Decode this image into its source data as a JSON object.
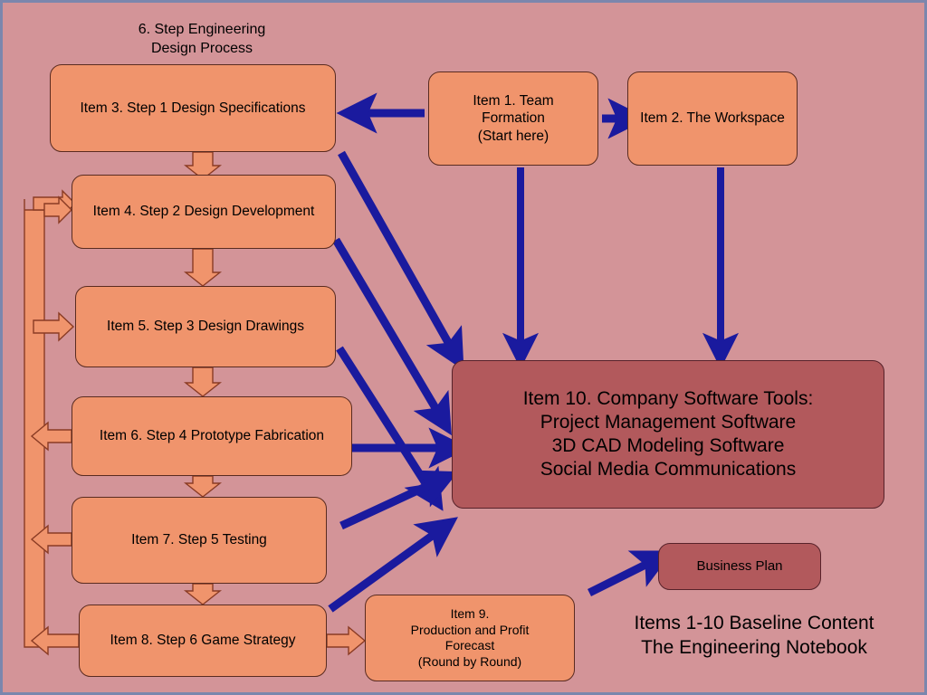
{
  "page": {
    "background_color": "#d39498",
    "border_color": "#7b86ad",
    "node_fill": "#f0946c",
    "node_border": "#5a2b20",
    "dark_node_fill": "#b2595c",
    "dark_node_border": "#57222a",
    "blue_arrow_color": "#1a1a9e",
    "peach_arrow_fill": "#f0946c",
    "peach_arrow_stroke": "#8a3b24"
  },
  "heading": {
    "line1": "6. Step Engineering",
    "line2": "Design Process"
  },
  "nodes": {
    "item1": {
      "line1": "Item 1. Team",
      "line2": "Formation",
      "line3": "(Start here)"
    },
    "item2": {
      "line1": "Item 2. The Workspace"
    },
    "item3": {
      "line1": "Item 3.  Step 1 Design Specifications"
    },
    "item4": {
      "line1": "Item 4.  Step 2 Design Development"
    },
    "item5": {
      "line1": "Item 5.  Step 3 Design  Drawings"
    },
    "item6": {
      "line1": "Item 6.  Step  4 Prototype Fabrication"
    },
    "item7": {
      "line1": "Item 7. Step 5  Testing"
    },
    "item8": {
      "line1": "Item 8. Step 6 Game Strategy"
    },
    "item9": {
      "line1": "Item 9.",
      "line2": "Production and Profit",
      "line3": "Forecast",
      "line4": "(Round by Round)"
    },
    "item10": {
      "line1": "Item 10. Company Software Tools:",
      "line2": "Project Management Software",
      "line3": "3D CAD Modeling Software",
      "line4": "Social Media Communications"
    },
    "business_plan": {
      "line1": "Business Plan"
    }
  },
  "baseline_note": {
    "line1": "Items 1-10 Baseline Content",
    "line2": "The  Engineering Notebook"
  },
  "connectors": {
    "blue_arrows": [
      {
        "name": "item1-to-item3",
        "from": "Item 1. Team Formation",
        "to": "Item 3. Step 1 Design Specifications",
        "direction": "left"
      },
      {
        "name": "item1-to-item2",
        "from": "Item 1. Team Formation",
        "to": "Item 2. The Workspace",
        "direction": "right"
      },
      {
        "name": "item1-to-item10",
        "from": "Item 1. Team Formation",
        "to": "Item 10. Company Software Tools",
        "direction": "down"
      },
      {
        "name": "item2-to-item10",
        "from": "Item 2. The Workspace",
        "to": "Item 10. Company Software Tools",
        "direction": "down"
      },
      {
        "name": "item3-to-item10",
        "from": "Item 3. Step 1 Design Specifications",
        "to": "Item 10. Company Software Tools",
        "direction": "diagonal-down-right"
      },
      {
        "name": "item4-to-item10",
        "from": "Item 4. Step 2 Design Development",
        "to": "Item 10. Company Software Tools",
        "direction": "diagonal-down-right"
      },
      {
        "name": "item6-to-item10",
        "from": "Item 6. Step 4 Prototype Fabrication",
        "to": "Item 10. Company Software Tools",
        "direction": "right"
      },
      {
        "name": "item5-to-item10",
        "from": "Item 5. Step 3 Design Drawings",
        "to": "Item 10. Company Software Tools",
        "direction": "diagonal-down-right"
      },
      {
        "name": "item7-to-item10",
        "from": "Item 7. Step 5 Testing",
        "to": "Item 10. Company Software Tools",
        "direction": "diagonal-up-right"
      },
      {
        "name": "item8-to-item10",
        "from": "Item 8. Step 6 Game Strategy",
        "to": "Item 10. Company Software Tools",
        "direction": "diagonal-up-right"
      },
      {
        "name": "to-business-plan",
        "from": "",
        "to": "Business Plan",
        "direction": "diagonal-up-right"
      }
    ],
    "peach_arrows": [
      {
        "name": "item3-to-item4",
        "direction": "down"
      },
      {
        "name": "item4-to-item5",
        "direction": "down"
      },
      {
        "name": "item5-to-item6",
        "direction": "down"
      },
      {
        "name": "item6-to-item7",
        "direction": "down"
      },
      {
        "name": "item7-to-item8",
        "direction": "down"
      },
      {
        "name": "item8-to-item9",
        "direction": "right"
      },
      {
        "name": "feedback-into-item4",
        "direction": "right"
      },
      {
        "name": "feedback-into-item5",
        "direction": "right"
      },
      {
        "name": "feedback-out-item6",
        "direction": "left"
      },
      {
        "name": "feedback-out-item7",
        "direction": "left"
      },
      {
        "name": "feedback-out-item8",
        "direction": "left"
      }
    ]
  }
}
